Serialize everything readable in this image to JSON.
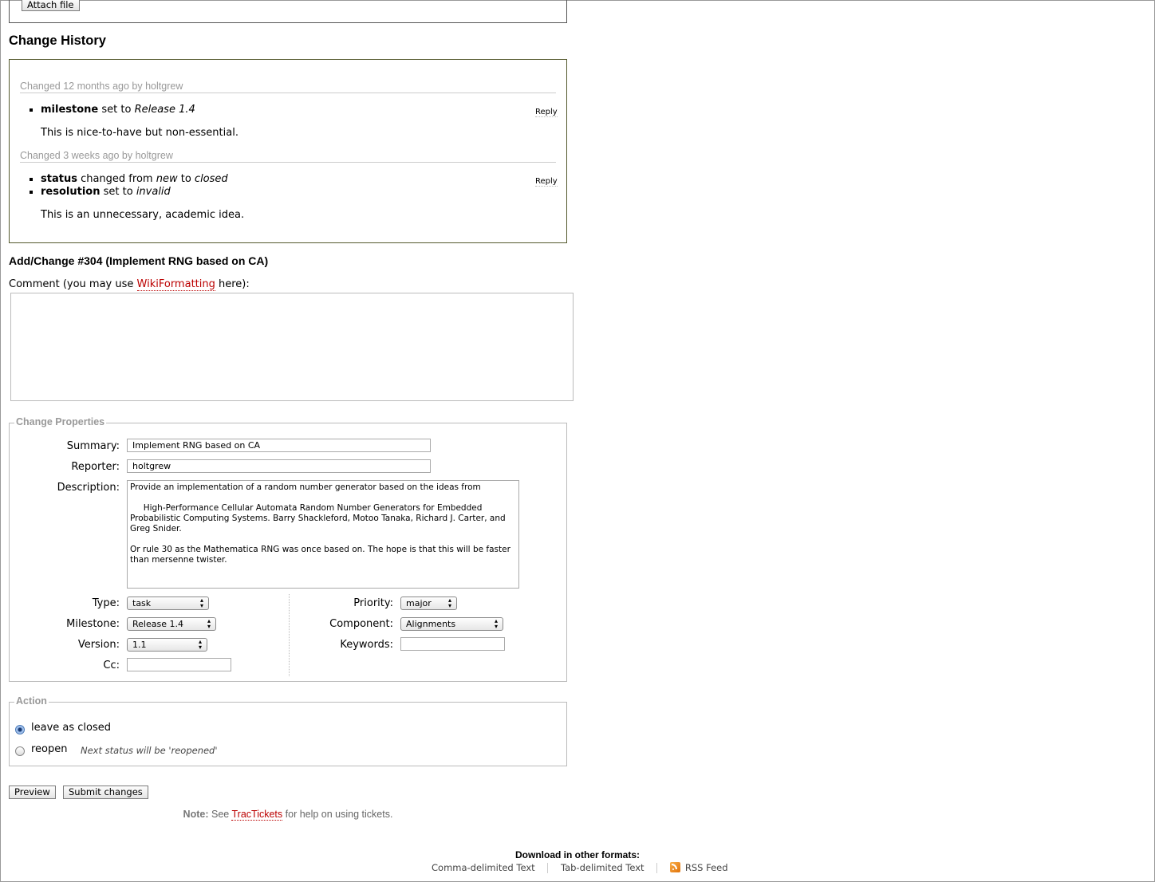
{
  "attach_label": "Attach file",
  "history_title": "Change History",
  "changes": [
    {
      "prefix": "Changed",
      "time": "12 months ago",
      "by": "by",
      "author": "holtgrew",
      "reply": "Reply",
      "items": [
        {
          "field": "milestone",
          "action": "set to",
          "value": "Release 1.4"
        }
      ],
      "comment": "This is nice-to-have but non-essential."
    },
    {
      "prefix": "Changed",
      "time": "3 weeks ago",
      "by": "by",
      "author": "holtgrew",
      "reply": "Reply",
      "items": [
        {
          "field": "status",
          "action": "changed from",
          "from": "new",
          "to_word": "to",
          "value": "closed"
        },
        {
          "field": "resolution",
          "action": "set to",
          "value": "invalid"
        }
      ],
      "comment": "This is an unnecessary, academic idea."
    }
  ],
  "add_change_title": "Add/Change #304 (Implement RNG based on CA)",
  "comment_prefix": "Comment (you may use",
  "comment_link": "WikiFormatting",
  "comment_suffix": "here):",
  "comment_value": "",
  "properties": {
    "legend": "Change Properties",
    "summary_label": "Summary:",
    "summary_value": "Implement RNG based on CA",
    "reporter_label": "Reporter:",
    "reporter_value": "holtgrew",
    "description_label": "Description:",
    "description_value": "Provide an implementation of a random number generator based on the ideas from\n\n     High-Performance Cellular Automata Random Number Generators for Embedded\nProbabilistic Computing Systems. Barry Shackleford, Motoo Tanaka, Richard J. Carter, and\nGreg Snider.\n\nOr rule 30 as the Mathematica RNG was once based on. The hope is that this will be faster\nthan mersenne twister.",
    "type_label": "Type:",
    "type_value": "task",
    "milestone_label": "Milestone:",
    "milestone_value": "Release 1.4",
    "version_label": "Version:",
    "version_value": "1.1",
    "cc_label": "Cc:",
    "cc_value": "",
    "priority_label": "Priority:",
    "priority_value": "major",
    "component_label": "Component:",
    "component_value": "Alignments",
    "keywords_label": "Keywords:",
    "keywords_value": ""
  },
  "action": {
    "legend": "Action",
    "leave_label": "leave as closed",
    "reopen_label": "reopen",
    "reopen_hint": "Next status will be 'reopened'"
  },
  "buttons": {
    "preview": "Preview",
    "submit": "Submit changes"
  },
  "note": {
    "label": "Note:",
    "prefix": "See",
    "link": "TracTickets",
    "suffix": "for help on using tickets."
  },
  "download": {
    "title": "Download in other formats:",
    "csv": "Comma-delimited Text",
    "tab": "Tab-delimited Text",
    "rss": "RSS Feed"
  }
}
